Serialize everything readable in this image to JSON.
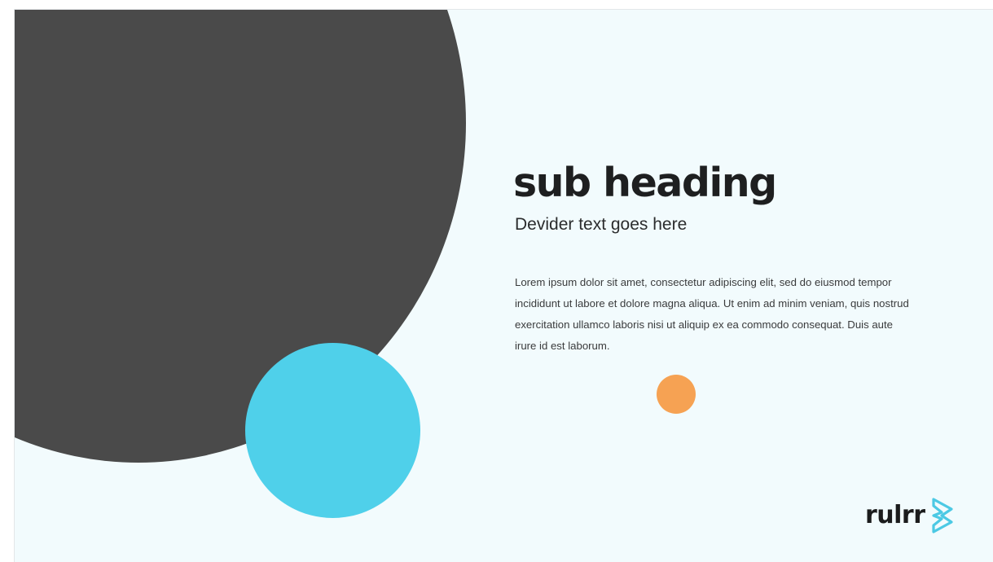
{
  "slide": {
    "heading": "sub heading",
    "divider_text": "Devider text goes here",
    "body": "Lorem ipsum dolor sit amet, consectetur adipiscing elit, sed do eiusmod tempor incididunt ut labore et dolore magna aliqua. Ut enim ad minim veniam, quis nostrud exercitation ullamco laboris nisi ut aliquip ex ea commodo consequat. Duis aute irure  id est laborum."
  },
  "logo": {
    "text": "rulrr",
    "icon": "rulrr-chevron-icon"
  },
  "colors": {
    "background": "#f2fbfd",
    "dark_circle": "#4a4a4a",
    "blue_circle": "#4fd0ea",
    "orange_dot": "#f6a253",
    "logo_accent": "#4cc9e4"
  }
}
